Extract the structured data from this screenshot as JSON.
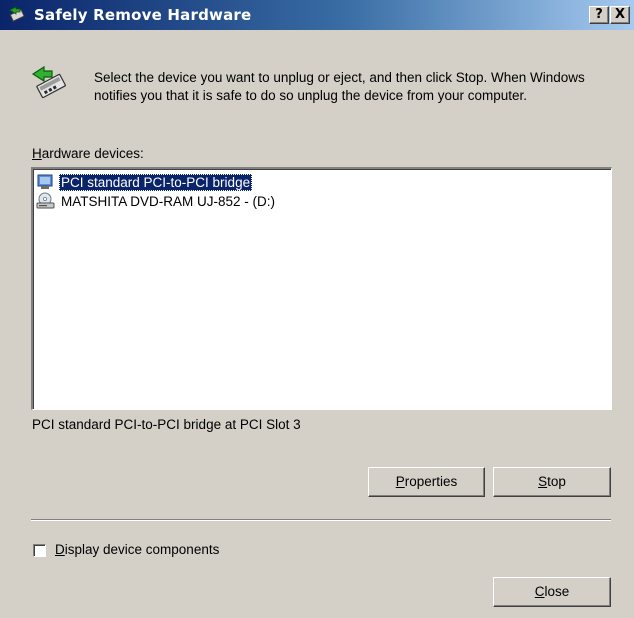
{
  "window": {
    "title": "Safely Remove Hardware",
    "help_button": "?",
    "close_button": "X",
    "title_icon": "safely-remove-hardware-icon"
  },
  "instructions": {
    "icon": "safely-remove-hardware-icon",
    "text": "Select the device you want to unplug or eject, and then click Stop. When Windows notifies you that it is safe to do so unplug the device from your computer."
  },
  "devices": {
    "label_prefix": "H",
    "label_rest": "ardware devices:",
    "items": [
      {
        "label": "PCI standard PCI-to-PCI bridge",
        "icon": "pci-bridge-icon",
        "selected": true
      },
      {
        "label": "MATSHITA DVD-RAM UJ-852 - (D:)",
        "icon": "dvd-drive-icon",
        "selected": false
      }
    ]
  },
  "status": {
    "text": "PCI standard PCI-to-PCI bridge at PCI Slot 3"
  },
  "buttons": {
    "properties_prefix": "P",
    "properties_rest": "roperties",
    "stop_prefix": "S",
    "stop_rest": "top",
    "close_prefix": "C",
    "close_rest": "lose"
  },
  "options": {
    "display_components_prefix": "D",
    "display_components_rest": "isplay device components",
    "display_components_checked": false
  },
  "colors": {
    "titlebar_start": "#0a246a",
    "titlebar_end": "#a6caf0",
    "dialog_face": "#d4d0c8",
    "selection": "#0a246a"
  }
}
